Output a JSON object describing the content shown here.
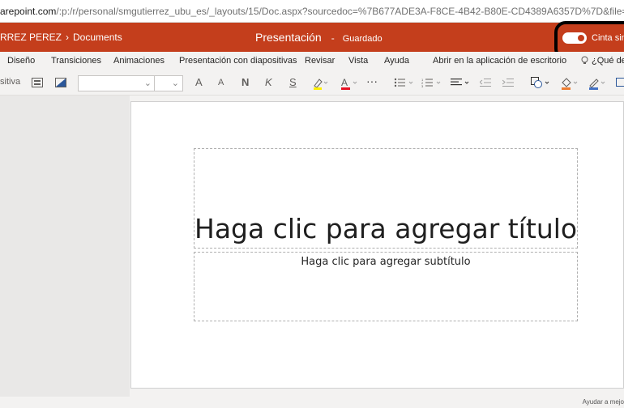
{
  "browser": {
    "url_host": "arepoint.com",
    "url_path": "/:p:/r/personal/smgutierrez_ubu_es/_layouts/15/Doc.aspx?sourcedoc=%7B677ADE3A-F8CE-4B42-B80E-CD4389A6357D%7D&file=Presentación.pptx&action=e"
  },
  "appbar": {
    "owner": "RREZ PEREZ",
    "separator": "›",
    "folder": "Documents",
    "doc_title": "Presentación",
    "dash": "-",
    "save_status": "Guardado",
    "toggle_label": "Cinta sim",
    "toggle_on": true
  },
  "tabs": [
    {
      "label": "Diseño"
    },
    {
      "label": "Transiciones"
    },
    {
      "label": "Animaciones"
    },
    {
      "label": "Presentación con diapositivas"
    },
    {
      "label": "Revisar"
    },
    {
      "label": "Vista"
    },
    {
      "label": "Ayuda"
    },
    {
      "label": "Abrir en la aplicación de escritorio"
    },
    {
      "label": "¿Qué des"
    }
  ],
  "toolbar": {
    "new_slide_partial": "sitiva",
    "font_name": "",
    "font_size": "",
    "grow_font": "A",
    "shrink_font": "A",
    "bold": "N",
    "italic": "K",
    "underline": "S",
    "more": "···"
  },
  "slide": {
    "title_placeholder": "Haga clic para agregar título",
    "subtitle_placeholder": "Haga clic para agregar subtítulo"
  },
  "status_bar": {
    "help_text": "Ayudar a mejo"
  },
  "colors": {
    "accent": "#c43e1c",
    "ribbon_bg": "#f3f2f1"
  }
}
